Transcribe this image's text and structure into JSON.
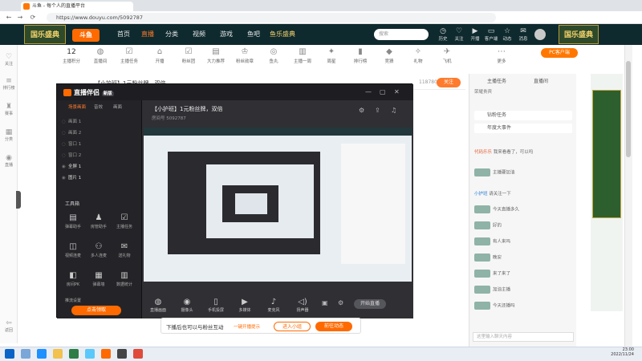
{
  "browser": {
    "tab_title": "斗鱼 - 每个人的直播平台",
    "url": "https://www.douyu.com/5092787",
    "back": "←",
    "forward": "→",
    "reload": "⟳"
  },
  "header": {
    "logo": "斗鱼",
    "banner_left": "国乐盛典",
    "banner_right": "国乐盛典",
    "nav": [
      "首页",
      "直播",
      "分类",
      "视频",
      "游戏",
      "鱼吧",
      "鱼乐盛典"
    ],
    "search_placeholder": "搜索",
    "icons": [
      "历史",
      "关注",
      "开播",
      "客户端",
      "动态",
      "消息"
    ]
  },
  "leftbar": [
    "关注",
    "排行榜",
    "赛事",
    "分类",
    "直播",
    "返回"
  ],
  "toolbar": {
    "fans_count": "12",
    "items": [
      "主播积分",
      "直播间",
      "主播任务",
      "开播",
      "粉丝团",
      "大力推荐",
      "粉丝勋章",
      "鱼丸",
      "主播一周",
      "周星",
      "排行榜",
      "竞猜",
      "礼物",
      "飞机",
      "更多"
    ],
    "pc_button": "PC客户端"
  },
  "room": {
    "title": "【小护班】1元粉丝牌，双倍",
    "follow_count": "118780",
    "follow_button": "关注"
  },
  "overlay": {
    "app_name": "直播伴侣",
    "app_badge": "新版",
    "left_tabs": [
      "场景画面",
      "音效",
      "画面"
    ],
    "scenes": [
      "画面 1",
      "画面 2",
      "窗口 1",
      "窗口 2",
      "全屏 1",
      "图片 1"
    ],
    "tools_title": "工具箱",
    "tools": [
      "弹幕助手",
      "房管助手",
      "主播任务",
      "视频连麦",
      "多人连麦",
      "送礼物",
      "房间PK",
      "弹幕墙",
      "数据统计",
      "更多",
      "推流设置"
    ],
    "activity_button": "点击领取",
    "title": "【小护班】1元粉丝牌，双倍",
    "subtitle": "房间号 5092787",
    "bottom_tools": [
      "直播画面",
      "摄像头",
      "手机投屏",
      "多媒体",
      "麦克风",
      "扬声器"
    ],
    "start_button": "开始直播"
  },
  "right_panel": {
    "tabs": [
      "主播任务",
      "直播间",
      "贡献"
    ],
    "tab2_label": "荣耀贵宾",
    "events": [
      "钻粉任务",
      "年度大事件"
    ],
    "chat": [
      {
        "user": "代码乐乐",
        "text": "我来看看了，可以吗"
      },
      {
        "user": "",
        "text": "主播要加油"
      },
      {
        "user": "小护班",
        "text": "请关注一下"
      },
      {
        "user": "",
        "text": "今天直播多久"
      },
      {
        "user": "",
        "text": "好的"
      },
      {
        "user": "",
        "text": "有人来吗"
      },
      {
        "user": "",
        "text": "晚安"
      },
      {
        "user": "",
        "text": "来了来了"
      },
      {
        "user": "",
        "text": "加油主播"
      },
      {
        "user": "",
        "text": "今天还播吗"
      }
    ],
    "input_placeholder": "这里输入聊天内容"
  },
  "live_bar": {
    "text": "下播后也可以与粉丝互动",
    "link": "一键开播提示",
    "button1": "进入小组",
    "button2": "前往动态"
  },
  "taskbar": {
    "time": "23:00",
    "date": "2022/11/24"
  },
  "colors": {
    "accent": "#ff6a00",
    "header": "#0f2a2e",
    "overlay": "#2b2b2f"
  }
}
